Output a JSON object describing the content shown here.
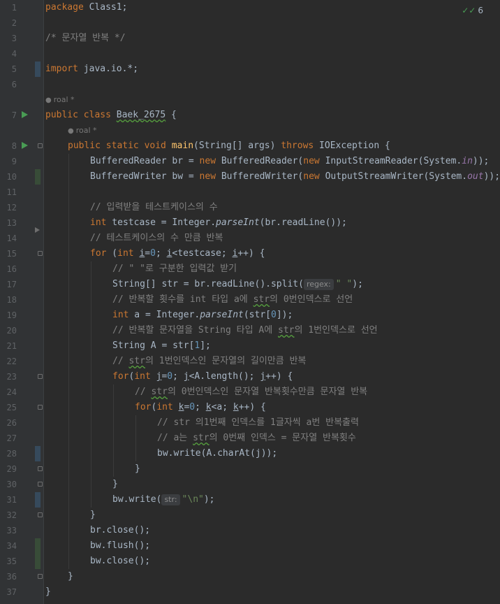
{
  "editor": {
    "inspections": {
      "icon": "check-double-icon",
      "count": "6"
    },
    "author_hints": [
      {
        "line_after": 6,
        "author": "roal *"
      },
      {
        "line_after": 7,
        "author": "roal *"
      }
    ],
    "line_numbers": [
      "1",
      "2",
      "3",
      "4",
      "5",
      "6",
      "7",
      "8",
      "9",
      "10",
      "11",
      "12",
      "13",
      "14",
      "15",
      "16",
      "17",
      "18",
      "19",
      "20",
      "21",
      "22",
      "23",
      "24",
      "25",
      "26",
      "27",
      "28",
      "29",
      "30",
      "31",
      "32",
      "33",
      "34",
      "35",
      "36",
      "37"
    ]
  },
  "code": {
    "l1": [
      "package",
      " Class1;"
    ],
    "l3": "/* 문자열 반복 */",
    "l5": [
      "import",
      " java.io.*;"
    ],
    "l7": [
      "public class ",
      "Baek_2675",
      " {"
    ],
    "l8": [
      "public static void ",
      "main",
      "(String[] args) ",
      "throws",
      " IOException {"
    ],
    "l9": [
      "BufferedReader br = ",
      "new",
      " BufferedReader(",
      "new",
      " InputStreamReader(System.",
      "in",
      "));"
    ],
    "l10": [
      "BufferedWriter bw = ",
      "new",
      " BufferedWriter(",
      "new",
      " OutputStreamWriter(System.",
      "out",
      "));"
    ],
    "l12": "// 입력받을 테스트케이스의 수",
    "l13": [
      "int",
      " testcase = Integer.",
      "parseInt",
      "(br.readLine());"
    ],
    "l14": "// 테스트케이스의 수 만큼 반복",
    "l15": [
      "for",
      " (",
      "int",
      " ",
      "i",
      "=",
      "0",
      "; ",
      "i",
      "<testcase; ",
      "i",
      "++) {"
    ],
    "l16": "// \" \"로 구분한 입력값 받기",
    "l17": [
      "String[] str = br.readLine().split(",
      "regex:",
      "\" \"",
      ");"
    ],
    "l18": [
      "// 반복할 횟수를 int 타입 a에 ",
      "str",
      "의 0번인덱스로 선언"
    ],
    "l19": [
      "int",
      " a = Integer.",
      "parseInt",
      "(str[",
      "0",
      "]);"
    ],
    "l20": [
      "// 반복할 문자열을 String 타입 A에 ",
      "str",
      "의 1번인덱스로 선언"
    ],
    "l21": [
      "String A = str[",
      "1",
      "];"
    ],
    "l22": [
      "// ",
      "str",
      "의 1번인덱스인 문자열의 길이만큼 반복"
    ],
    "l23": [
      "for",
      "(",
      "int",
      " ",
      "j",
      "=",
      "0",
      "; ",
      "j",
      "<A.length(); ",
      "j",
      "++) {"
    ],
    "l24": [
      "// ",
      "str",
      "의 0번인덱스인 문자열 반복횟수만큼 문자열 반복"
    ],
    "l25": [
      "for",
      "(",
      "int",
      " ",
      "k",
      "=",
      "0",
      "; ",
      "k",
      "<a; ",
      "k",
      "++) {"
    ],
    "l26": "// str 의1번째 인덱스를 1글자씩 a번 반복출력",
    "l27": [
      "// a는 ",
      "str",
      "의 0번째 인덱스 = 문자열 반복횟수"
    ],
    "l28": "bw.write(A.charAt(j));",
    "l29": "}",
    "l30": "}",
    "l31": [
      "bw.write(",
      "str:",
      "\"\\n\"",
      ");"
    ],
    "l32": "}",
    "l33": "br.close();",
    "l34": "bw.flush();",
    "l35": "bw.close();",
    "l36": "}",
    "l37": "}"
  }
}
